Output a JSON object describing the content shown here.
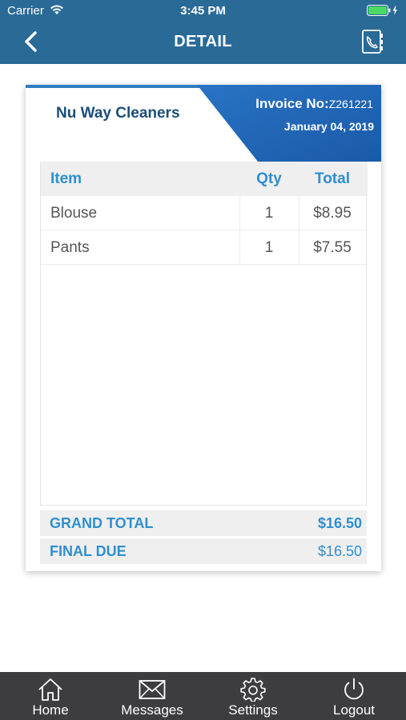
{
  "status_bar": {
    "carrier": "Carrier",
    "time": "3:45 PM",
    "wifi_icon": "wifi-icon",
    "battery_icon": "battery-icon",
    "battery_color": "#4cd964"
  },
  "nav": {
    "title": "DETAIL",
    "back_icon": "chevron-left-icon",
    "contacts_icon": "phone-book-icon",
    "background": "#2a6a97"
  },
  "invoice": {
    "company": "Nu Way Cleaners",
    "number_label": "Invoice No:",
    "number": "Z261221",
    "date": "January 04, 2019",
    "accent_color": "#2f7dc1",
    "columns": [
      "Item",
      "Qty",
      "Total"
    ],
    "items": [
      {
        "item": "Blouse",
        "qty": "1",
        "total": "$8.95"
      },
      {
        "item": "Pants",
        "qty": "1",
        "total": "$7.55"
      }
    ],
    "grand_total_label": "GRAND TOTAL",
    "grand_total": "$16.50",
    "final_due_label": "FINAL DUE",
    "final_due": "$16.50"
  },
  "tabbar": {
    "background": "#3d3d3f",
    "tabs": [
      {
        "label": "Home",
        "icon": "home-icon"
      },
      {
        "label": "Messages",
        "icon": "envelope-icon"
      },
      {
        "label": "Settings",
        "icon": "gear-icon"
      },
      {
        "label": "Logout",
        "icon": "power-icon"
      }
    ]
  }
}
